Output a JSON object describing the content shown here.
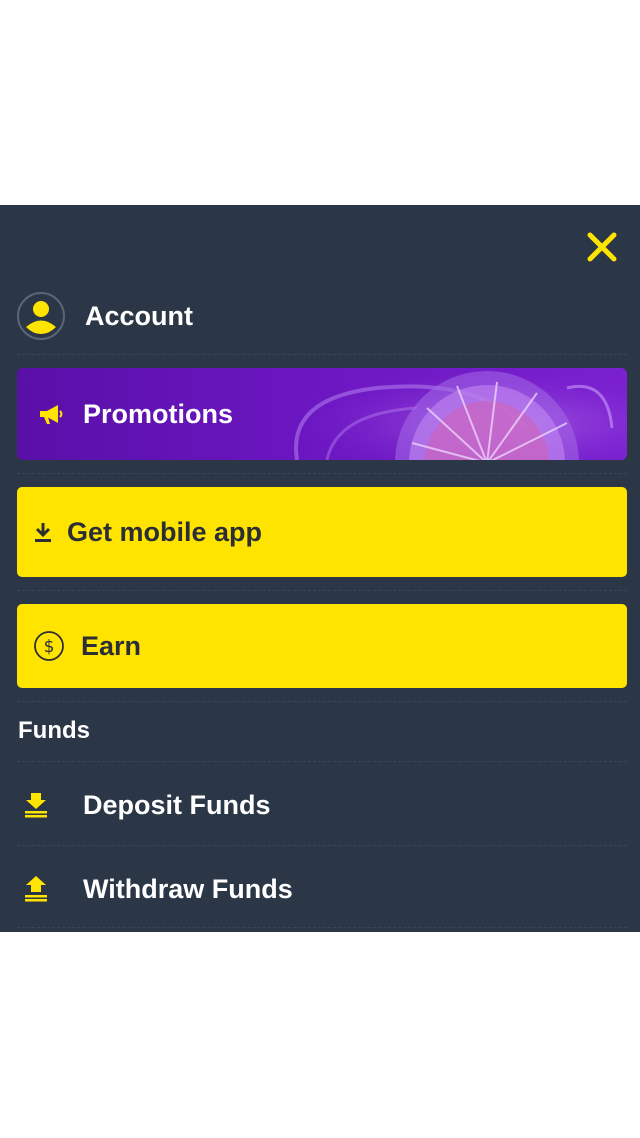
{
  "colors": {
    "menu_bg": "#2b3647",
    "accent_yellow": "#ffe400",
    "promo_purple": "#6a16c0",
    "text_light": "#ffffff",
    "text_dark": "#2b2f35"
  },
  "header": {
    "close_icon": "close-icon"
  },
  "account": {
    "label": "Account",
    "icon": "user-avatar-icon"
  },
  "promotions": {
    "label": "Promotions",
    "icon": "megaphone-icon"
  },
  "mobile_app": {
    "label": "Get mobile app",
    "icon": "download-icon"
  },
  "earn": {
    "label": "Earn",
    "icon": "dollar-coin-icon"
  },
  "funds": {
    "heading": "Funds",
    "items": [
      {
        "label": "Deposit Funds",
        "icon": "deposit-icon"
      },
      {
        "label": "Withdraw Funds",
        "icon": "withdraw-icon"
      }
    ]
  }
}
